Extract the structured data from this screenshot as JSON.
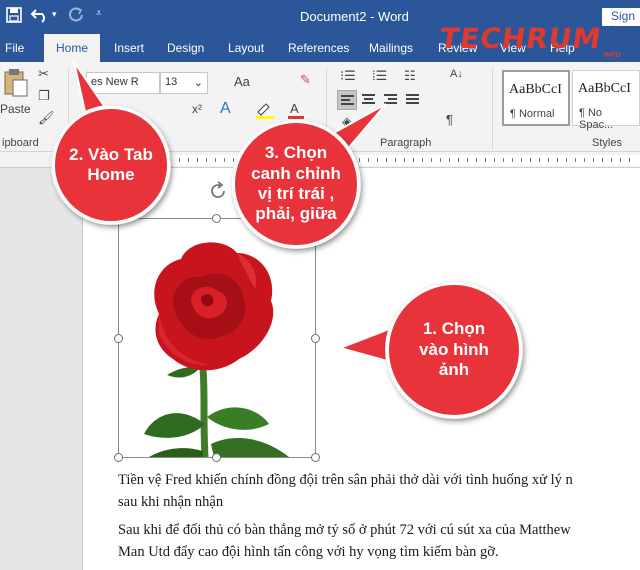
{
  "titlebar": {
    "title": "Document2 - Word",
    "signin": "Sign in"
  },
  "tabs": [
    {
      "label": "File",
      "active": false
    },
    {
      "label": "Home",
      "active": true
    },
    {
      "label": "Insert",
      "active": false
    },
    {
      "label": "Design",
      "active": false
    },
    {
      "label": "Layout",
      "active": false
    },
    {
      "label": "References",
      "active": false
    },
    {
      "label": "Mailings",
      "active": false
    },
    {
      "label": "Review",
      "active": false
    },
    {
      "label": "View",
      "active": false
    },
    {
      "label": "Help",
      "active": false
    }
  ],
  "logo": {
    "text": "TECHRUM",
    "sub": "INFO",
    "color": "#e03a2f"
  },
  "ribbon": {
    "paste_label": "Paste",
    "clipboard_label": "ipboard",
    "font_name": "es New R",
    "font_size": "13",
    "font_grow": "Aa",
    "paragraph_label": "Paragraph",
    "styles_label": "Styles",
    "styles": [
      {
        "sample": "AaBbCcI",
        "name": "¶ Normal"
      },
      {
        "sample": "AaBbCcI",
        "name": "¶ No Spac..."
      }
    ]
  },
  "callouts": {
    "one": "1. Chọn vào hình ảnh",
    "two": "2. Vào Tab Home",
    "three": "3. Chọn canh chỉnh vị trí trái , phải, giữa",
    "color": "#e8333b"
  },
  "document": {
    "line1": "Tiền vệ Fred khiến chính đồng đội trên sân phải thở dài với tình huống xử lý n",
    "line2": "sau khi nhận nhận",
    "line3": "Sau khi để đối thủ có bàn thắng mở tỷ số ở phút 72 với cú sút xa của Matthew",
    "line4": "Man Utd đẩy cao đội hình tấn công với hy vọng tìm kiếm bàn gỡ."
  },
  "colors": {
    "title_bar": "#2b579a",
    "ribbon": "#f3f3f3",
    "accent": "#2b579a"
  }
}
